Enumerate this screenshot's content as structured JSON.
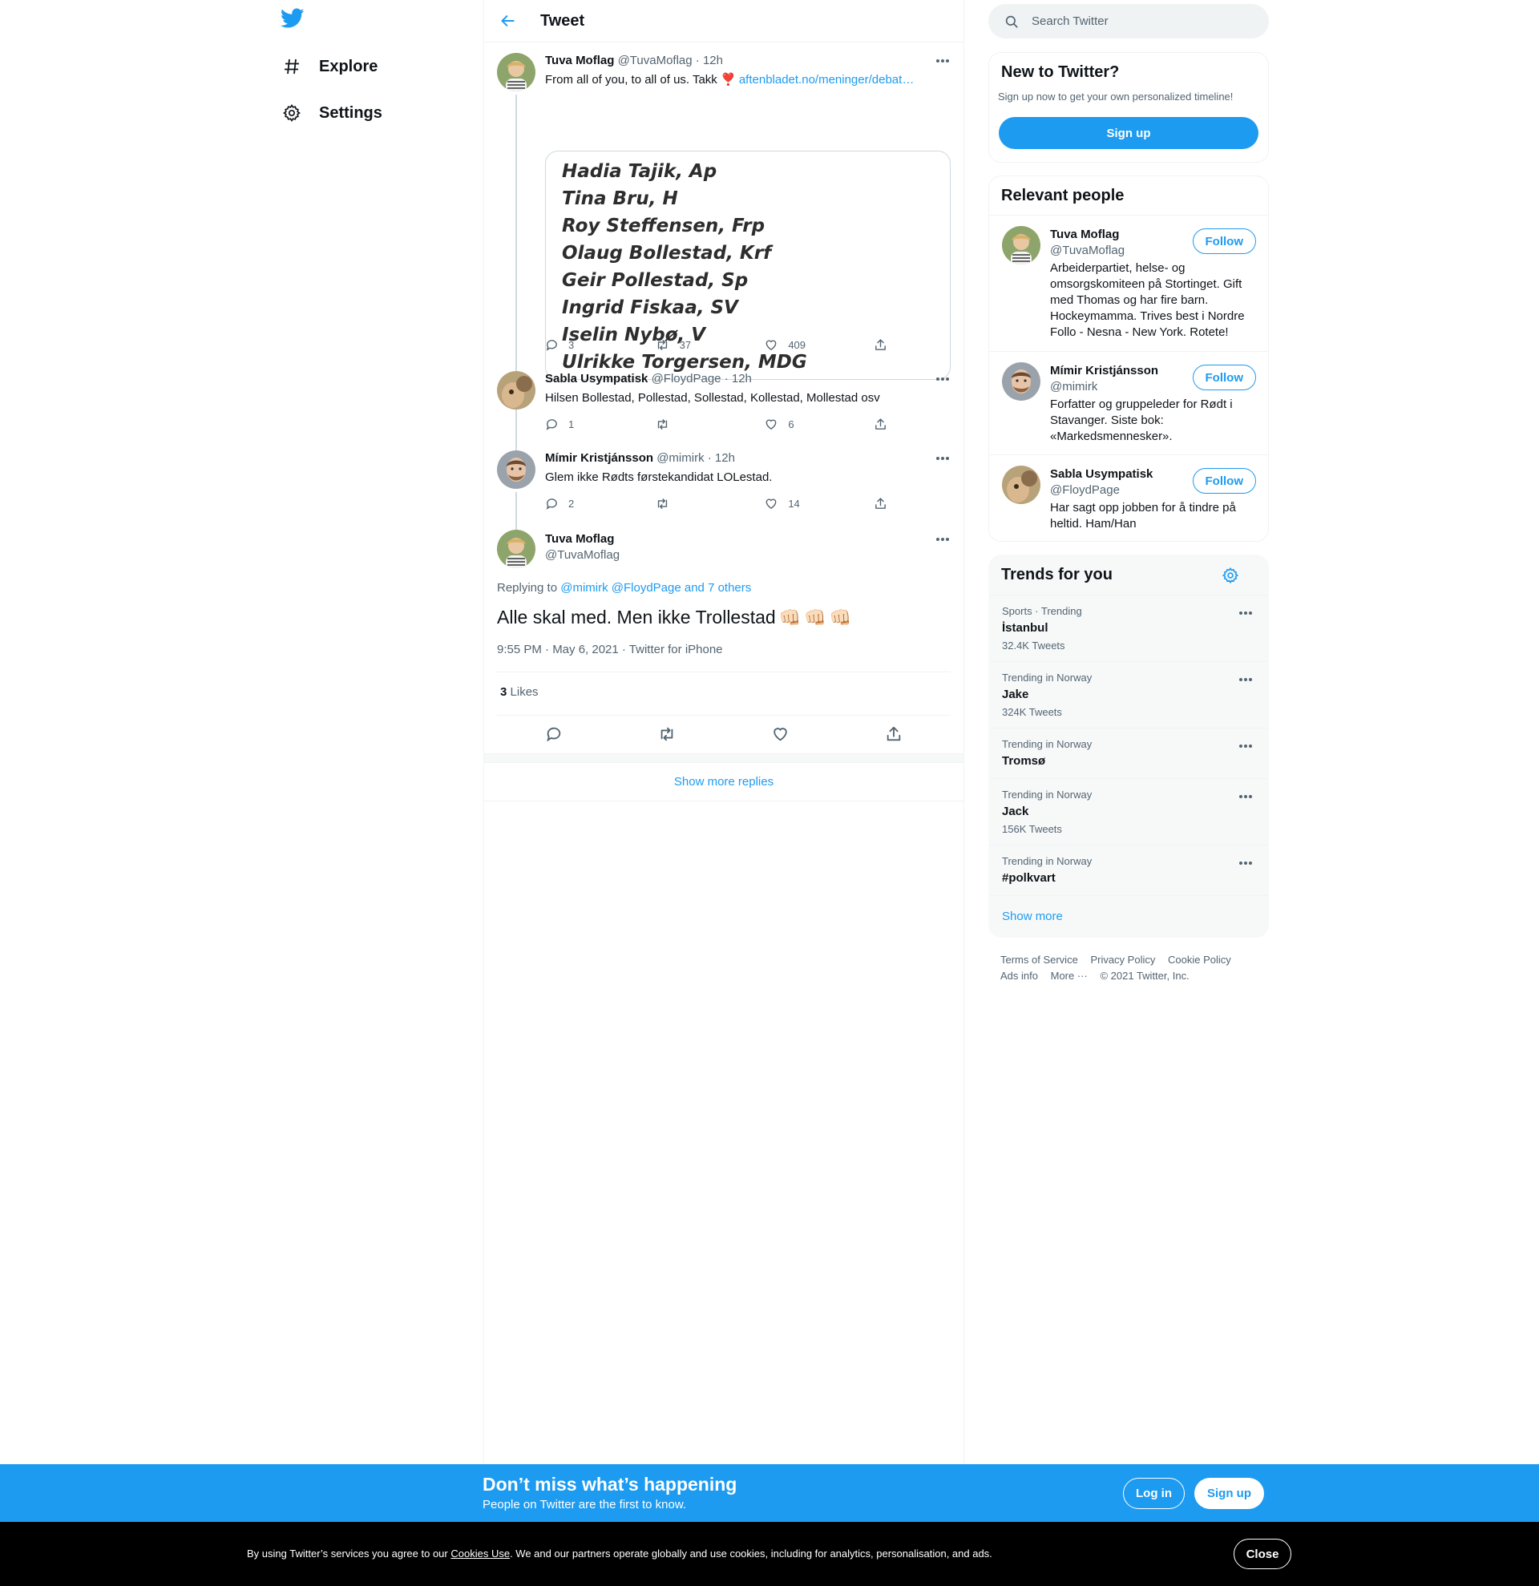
{
  "nav": {
    "items": [
      {
        "label": "Explore",
        "icon": "hashtag-icon"
      },
      {
        "label": "Settings",
        "icon": "gear-icon"
      }
    ]
  },
  "header": {
    "title": "Tweet"
  },
  "thread": [
    {
      "name": "Tuva Moflag",
      "handle": "@TuvaMoflag",
      "time": "· 12h",
      "text": "From all of you, to all of us. Takk ❣️",
      "link": "aftenbladet.no/meninger/debat…",
      "image_lines": [
        "Hadia Tajik, Ap",
        "Tina Bru, H",
        "Roy Steffensen, Frp",
        "Olaug Bollestad, Krf",
        "Geir Pollestad, Sp",
        "Ingrid Fiskaa, SV",
        "Iselin Nybø, V",
        "Ulrikke Torgersen, MDG"
      ],
      "replies": "3",
      "retweets": "37",
      "likes": "409"
    },
    {
      "name": "Sabla Usympatisk",
      "handle": "@FloydPage",
      "time": "· 12h",
      "text": "Hilsen Bollestad, Pollestad, Sollestad, Kollestad, Mollestad osv",
      "replies": "1",
      "retweets": "",
      "likes": "6"
    },
    {
      "name": "Mímir Kristjánsson",
      "handle": "@mimirk",
      "time": "· 12h",
      "text": "Glem ikke Rødts førstekandidat LOLestad.",
      "replies": "2",
      "retweets": "",
      "likes": "14"
    }
  ],
  "focus": {
    "name": "Tuva Moflag",
    "handle": "@TuvaMoflag",
    "replying_prefix": "Replying to",
    "replying_to": "@mimirk @FloydPage and 7 others",
    "text": "Alle skal med. Men ikke Trollestad",
    "emoji": "👊🏻👊🏻👊🏻",
    "meta": "9:55 PM · May 6, 2021 · Twitter for iPhone",
    "likes_count": "3",
    "likes_label": "Likes"
  },
  "show_more_replies": "Show more replies",
  "search": {
    "placeholder": "Search Twitter"
  },
  "new_to_twitter": {
    "title": "New to Twitter?",
    "subtitle": "Sign up now to get your own personalized timeline!",
    "button": "Sign up"
  },
  "relevant": {
    "title": "Relevant people",
    "people": [
      {
        "name": "Tuva Moflag",
        "handle": "@TuvaMoflag",
        "bio": "Arbeiderpartiet, helse- og omsorgskomiteen på Stortinget. Gift med Thomas og har fire barn. Hockeymamma. Trives best i Nordre Follo - Nesna - New York. Rotete!",
        "follow": "Follow"
      },
      {
        "name": "Mímir Kristjánsson",
        "handle": "@mimirk",
        "bio": "Forfatter og gruppeleder for Rødt i Stavanger. Siste bok: «Markedsmennesker».",
        "follow": "Follow"
      },
      {
        "name": "Sabla Usympatisk",
        "handle": "@FloydPage",
        "bio": "Har sagt opp jobben for å tindre på heltid. Ham/Han",
        "follow": "Follow"
      }
    ]
  },
  "trends": {
    "title": "Trends for you",
    "items": [
      {
        "context": "Sports · Trending",
        "name": "İstanbul",
        "count": "32.4K Tweets"
      },
      {
        "context": "Trending in Norway",
        "name": "Jake",
        "count": "324K Tweets"
      },
      {
        "context": "Trending in Norway",
        "name": "Tromsø",
        "count": ""
      },
      {
        "context": "Trending in Norway",
        "name": "Jack",
        "count": "156K Tweets"
      },
      {
        "context": "Trending in Norway",
        "name": "#polkvart",
        "count": ""
      }
    ],
    "show_more": "Show more"
  },
  "footer": {
    "links": [
      "Terms of Service",
      "Privacy Policy",
      "Cookie Policy",
      "Ads info",
      "More ···"
    ],
    "copyright": "© 2021 Twitter, Inc."
  },
  "banner": {
    "title": "Don’t miss what’s happening",
    "subtitle": "People on Twitter are the first to know.",
    "login": "Log in",
    "signup": "Sign up"
  },
  "cookie": {
    "before": "By using Twitter’s services you agree to our ",
    "link": "Cookies Use",
    "after": ". We and our partners operate globally and use cookies, including for analytics, personalisation, and ads.",
    "close": "Close"
  },
  "colors": {
    "accent": "#1d9bf0",
    "text": "#0f1419",
    "muted": "#536471"
  }
}
